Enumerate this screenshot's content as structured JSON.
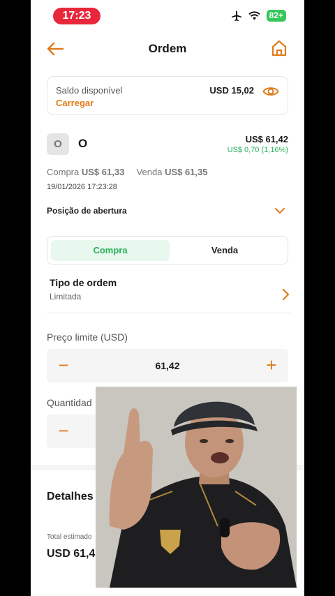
{
  "status_bar": {
    "time": "17:23",
    "battery": "82+"
  },
  "header": {
    "title": "Ordem"
  },
  "balance": {
    "label": "Saldo disponível",
    "link": "Carregar",
    "value": "USD 15,02"
  },
  "stock": {
    "badge": "O",
    "name": "O",
    "price": "US$ 61,42",
    "change": "US$ 0,70 (1,16%)",
    "buy_label": "Compra",
    "buy_value": "US$ 61,33",
    "sell_label": "Venda",
    "sell_value": "US$ 61,35",
    "datetime": "19/01/2026 17:23:28"
  },
  "position": {
    "label": "Posição de abertura"
  },
  "toggle": {
    "buy": "Compra",
    "sell": "Venda",
    "selected": "Compra"
  },
  "order_type": {
    "label": "Tipo de ordem",
    "value": "Limitada"
  },
  "limit_price": {
    "label": "Preço limite (USD)",
    "value": "61,42",
    "minus": "−",
    "plus": "+"
  },
  "quantity": {
    "label": "Quantidad",
    "minus": "−"
  },
  "details": {
    "title": "Detalhes",
    "total_label": "Total estimado",
    "total_value": "USD 61,4"
  },
  "colors": {
    "accent": "#e07b1a",
    "positive": "#23b05a",
    "time_pill": "#e8273a",
    "battery": "#34c759"
  }
}
